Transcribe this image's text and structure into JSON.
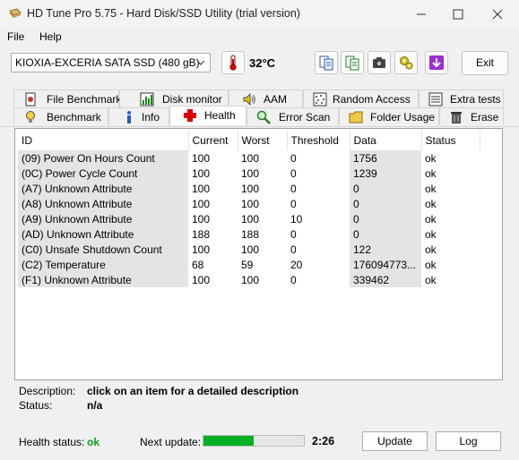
{
  "window": {
    "title": "HD Tune Pro 5.75 - Hard Disk/SSD Utility (trial version)"
  },
  "menu": {
    "file": "File",
    "help": "Help"
  },
  "toolbar": {
    "drive": "KIOXIA-EXCERIA SATA SSD (480 gB)",
    "temperature": "32°C",
    "exit_label": "Exit"
  },
  "tabs_top": [
    "File Benchmark",
    "Disk monitor",
    "AAM",
    "Random Access",
    "Extra tests"
  ],
  "tabs_bottom": [
    "Benchmark",
    "Info",
    "Health",
    "Error Scan",
    "Folder Usage",
    "Erase"
  ],
  "active_tab": "Health",
  "table": {
    "columns": [
      "ID",
      "Current",
      "Worst",
      "Threshold",
      "Data",
      "Status"
    ],
    "rows": [
      [
        "(09) Power On Hours Count",
        "100",
        "100",
        "0",
        "1756",
        "ok"
      ],
      [
        "(0C) Power Cycle Count",
        "100",
        "100",
        "0",
        "1239",
        "ok"
      ],
      [
        "(A7) Unknown Attribute",
        "100",
        "100",
        "0",
        "0",
        "ok"
      ],
      [
        "(A8) Unknown Attribute",
        "100",
        "100",
        "0",
        "0",
        "ok"
      ],
      [
        "(A9) Unknown Attribute",
        "100",
        "100",
        "10",
        "0",
        "ok"
      ],
      [
        "(AD) Unknown Attribute",
        "188",
        "188",
        "0",
        "0",
        "ok"
      ],
      [
        "(C0) Unsafe Shutdown Count",
        "100",
        "100",
        "0",
        "122",
        "ok"
      ],
      [
        "(C2) Temperature",
        "68",
        "59",
        "20",
        "176094773...",
        "ok"
      ],
      [
        "(F1) Unknown Attribute",
        "100",
        "100",
        "0",
        "339462",
        "ok"
      ]
    ]
  },
  "description": {
    "label": "Description:",
    "value": "click on an item for a detailed description",
    "status_label": "Status:",
    "status_value": "n/a"
  },
  "footer": {
    "health_label": "Health status:",
    "health_value": "ok",
    "health_color": "#12a012",
    "next_update_label": "Next update:",
    "next_update_progress": 0.5,
    "countdown": "2:26",
    "update_label": "Update",
    "log_label": "Log"
  },
  "icons": {
    "title": "app-hdd-icon",
    "toolbar": [
      "thermometer-icon",
      "copy-info-icon",
      "copy-all-icon",
      "screenshot-camera-icon",
      "options-gears-icon",
      "download-icon"
    ]
  }
}
